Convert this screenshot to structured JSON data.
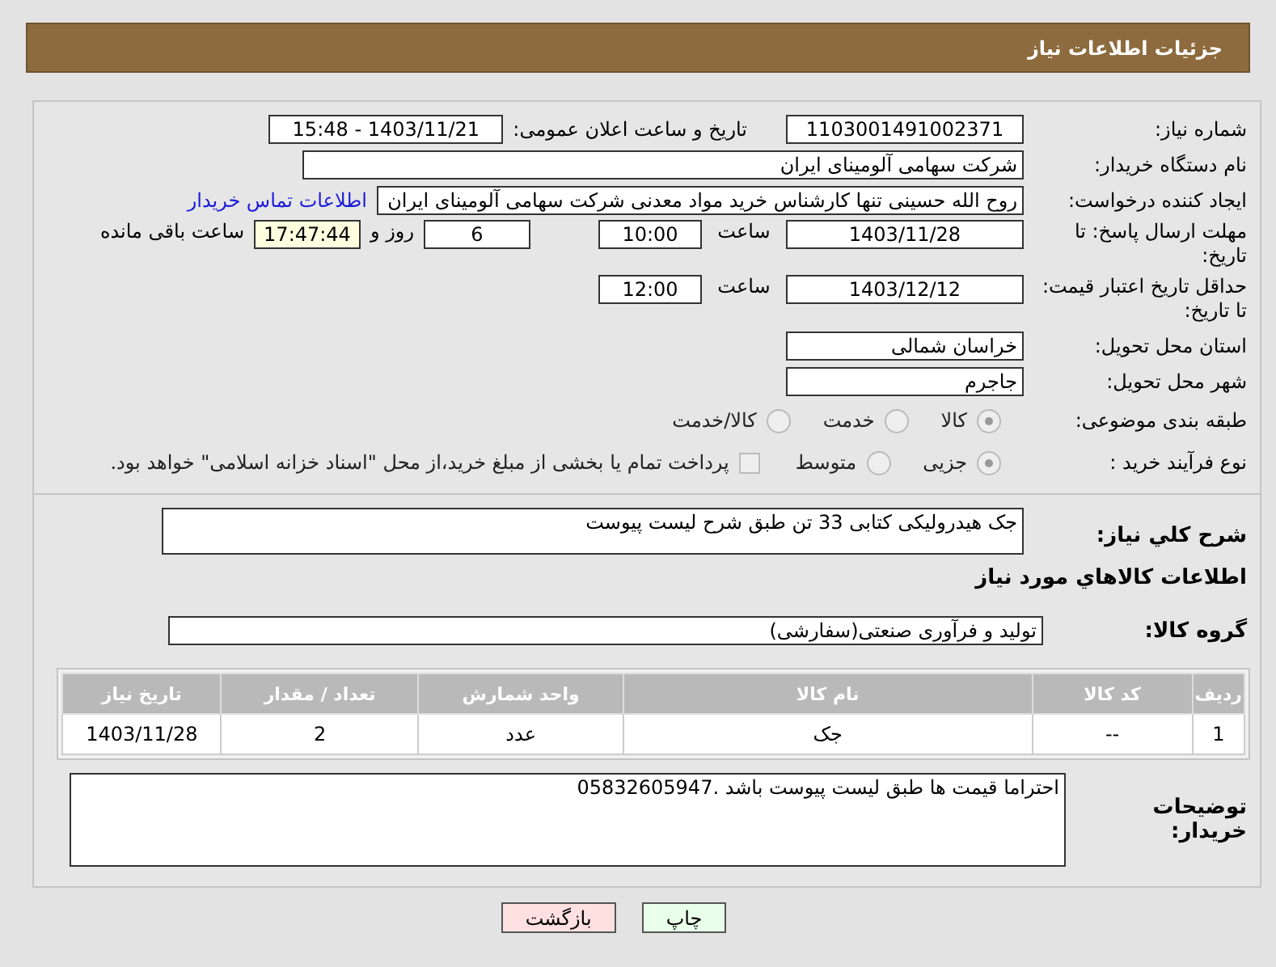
{
  "header": {
    "title": "جزئیات اطلاعات نیاز"
  },
  "need_number": {
    "label": "شماره نیاز:",
    "value": "1103001491002371"
  },
  "announce": {
    "label": "تاریخ و ساعت اعلان عمومی:",
    "value": "1403/11/21 - 15:48"
  },
  "buyer": {
    "label": "نام دستگاه خریدار:",
    "value": "شرکت سهامی آلومینای ایران"
  },
  "creator": {
    "label": "ایجاد کننده درخواست:",
    "value": "روح الله حسینی تنها کارشناس خرید مواد معدنی شرکت سهامی آلومینای ایران",
    "link": "اطلاعات تماس خریدار"
  },
  "deadline": {
    "label": "مهلت ارسال پاسخ: تا تاریخ:",
    "date": "1403/11/28",
    "time_label": "ساعت",
    "time": "10:00",
    "days": "6",
    "days_label": "روز و",
    "remaining": "17:47:44",
    "remaining_label": "ساعت باقی مانده"
  },
  "validity": {
    "label": "حداقل تاریخ اعتبار قیمت: تا تاریخ:",
    "date": "1403/12/12",
    "time_label": "ساعت",
    "time": "12:00"
  },
  "province": {
    "label": "استان محل تحویل:",
    "value": "خراسان شمالی"
  },
  "city": {
    "label": "شهر محل تحویل:",
    "value": "جاجرم"
  },
  "category": {
    "label": "طبقه بندی موضوعی:",
    "options": [
      {
        "label": "کالا",
        "selected": true
      },
      {
        "label": "خدمت",
        "selected": false
      },
      {
        "label": "کالا/خدمت",
        "selected": false
      }
    ]
  },
  "process": {
    "label": "نوع فرآیند خرید :",
    "options": [
      {
        "label": "جزیی",
        "selected": true
      },
      {
        "label": "متوسط",
        "selected": false
      }
    ],
    "treasury": {
      "label": "پرداخت تمام یا بخشی از مبلغ خرید،از محل \"اسناد خزانه اسلامی\" خواهد بود.",
      "checked": false
    }
  },
  "description": {
    "label": "شرح کلي نياز:",
    "value": "جک هیدرولیکی کتابی 33 تن طبق شرح لیست پیوست"
  },
  "goods_heading": "اطلاعات کالاهاي مورد نياز",
  "goods_group": {
    "label": "گروه کالا:",
    "value": "تولید و فرآوری صنعتی(سفارشی)"
  },
  "table": {
    "columns": [
      "ردیف",
      "کد کالا",
      "نام کالا",
      "واحد شمارش",
      "تعداد / مقدار",
      "تاریخ نیاز"
    ],
    "rows": [
      [
        "1",
        "--",
        "جک",
        "عدد",
        "2",
        "1403/11/28"
      ]
    ]
  },
  "notes": {
    "label": "توضیحات خریدار:",
    "value": "احتراما قیمت ها طبق لیست پیوست باشد .05832605947"
  },
  "buttons": [
    {
      "label": "چاپ",
      "kind": "print"
    },
    {
      "label": "بازگشت",
      "kind": "back"
    }
  ]
}
